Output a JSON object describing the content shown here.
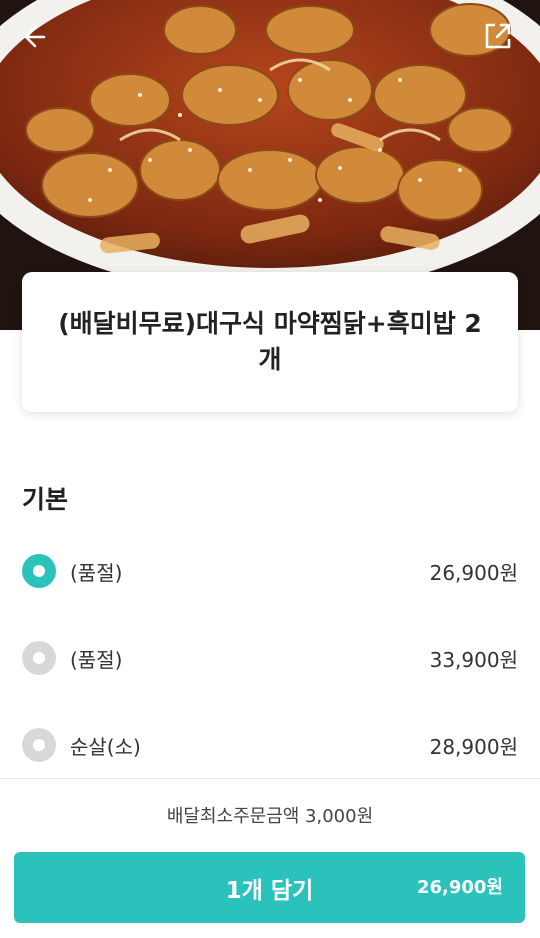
{
  "hero": {
    "image_name": "jjimdak-dish-photo",
    "back_icon": "arrow-left-icon",
    "share_icon": "share-external-icon"
  },
  "product": {
    "title": "(배달비무료)대구식 마약찜닭+흑미밥 2개"
  },
  "options_section": {
    "title": "기본",
    "options": [
      {
        "label": "(품절)",
        "price": "26,900원",
        "selected": true
      },
      {
        "label": "(품절)",
        "price": "33,900원",
        "selected": false
      },
      {
        "label": "순살(소)",
        "price": "28,900원",
        "selected": false
      }
    ]
  },
  "footer": {
    "min_order": "배달최소주문금액 3,000원",
    "add_button_label": "1개 담기",
    "add_button_price": "26,900원"
  },
  "colors": {
    "accent": "#2cc2bc",
    "radio_off": "#d8d8d8"
  }
}
